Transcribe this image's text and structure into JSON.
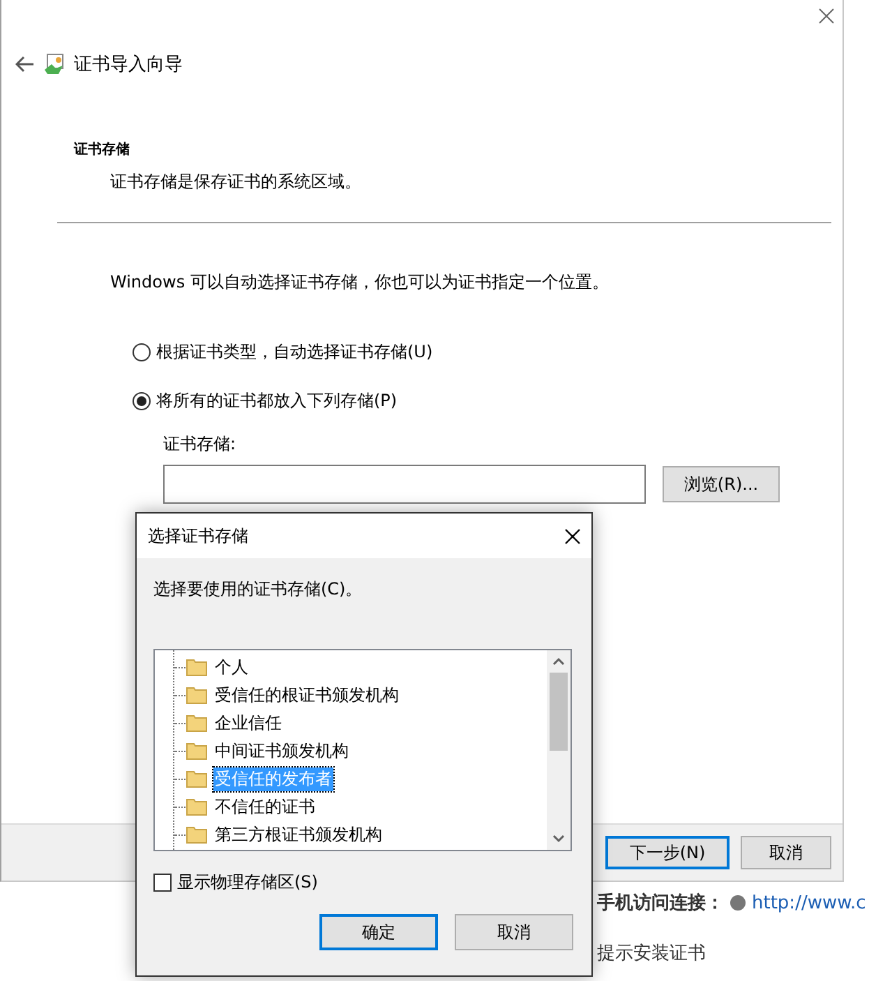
{
  "wizard": {
    "title": "证书导入向导",
    "section_title": "证书存储",
    "section_desc": "证书存储是保存证书的系统区域。",
    "intro": "Windows 可以自动选择证书存储，你也可以为证书指定一个位置。",
    "options": [
      {
        "label": "根据证书类型，自动选择证书存储(U)",
        "selected": false
      },
      {
        "label": "将所有的证书都放入下列存储(P)",
        "selected": true
      }
    ],
    "store_label": "证书存储:",
    "browse_button": "浏览(R)...",
    "buttons": [
      {
        "label": "下一步(N)",
        "default": true
      },
      {
        "label": "取消",
        "default": false
      }
    ]
  },
  "background_page": {
    "link_label": "手机访问连接：",
    "link": "http://www.c",
    "text": "提示安装证书"
  },
  "dialog": {
    "title": "选择证书存储",
    "prompt": "选择要使用的证书存储(C)。",
    "stores": [
      {
        "label": "个人",
        "selected": false
      },
      {
        "label": "受信任的根证书颁发机构",
        "selected": false
      },
      {
        "label": "企业信任",
        "selected": false
      },
      {
        "label": "中间证书颁发机构",
        "selected": false
      },
      {
        "label": "受信任的发布者",
        "selected": true
      },
      {
        "label": "不信任的证书",
        "selected": false
      },
      {
        "label": "第三方根证书颁发机构",
        "selected": false
      }
    ],
    "show_physical": {
      "label": "显示物理存储区(S)",
      "checked": false
    },
    "buttons": [
      {
        "label": "确定",
        "default": true
      },
      {
        "label": "取消",
        "default": false
      }
    ]
  }
}
